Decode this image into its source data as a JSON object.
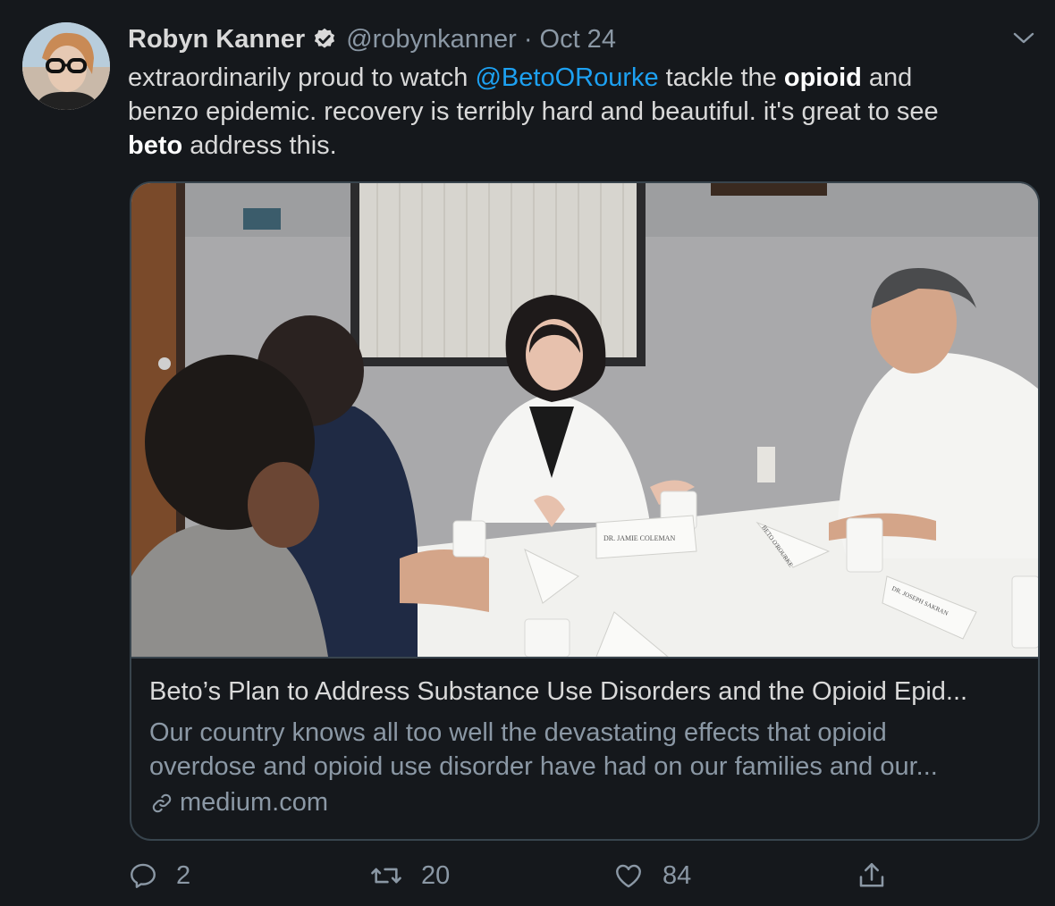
{
  "user": {
    "display_name": "Robyn Kanner",
    "handle": "@robynkanner",
    "separator": "·",
    "date": "Oct 24"
  },
  "tweet": {
    "line1_a": "extraordinarily proud to watch ",
    "mention": "@BetoORourke",
    "line1_b": " tackle the ",
    "bold1": "opioid",
    "line1_c": " and",
    "line2": "benzo epidemic. recovery is terribly hard and beautiful. it's great to see",
    "bold2": "beto",
    "line3": " address this."
  },
  "card": {
    "title": "Beto’s Plan to Address Substance Use Disorders and the Opioid Epid...",
    "desc_line1": "Our country knows all too well the devastating effects that opioid",
    "desc_line2": "overdose and opioid use disorder have had on our families and our...",
    "domain": "medium.com",
    "image_nameplates": [
      "DR. JAMIE COLEMAN",
      "BETO O'ROURKE",
      "DR. JOSEPH SAKRAN"
    ]
  },
  "actions": {
    "reply_count": "2",
    "retweet_count": "20",
    "like_count": "84"
  },
  "icons": {
    "verified": "verified-badge-icon",
    "caret": "chevron-down-icon",
    "link": "link-icon",
    "reply": "reply-icon",
    "retweet": "retweet-icon",
    "like": "heart-icon",
    "share": "share-icon"
  },
  "colors": {
    "background": "#15181c",
    "text": "#d9d9d9",
    "secondary": "#8b98a5",
    "accent": "#1da1f2",
    "border": "#38444d"
  }
}
